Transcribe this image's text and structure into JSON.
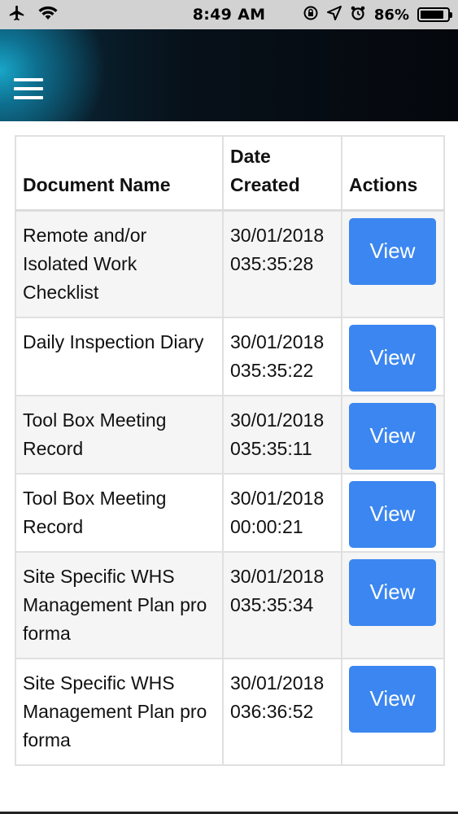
{
  "status_bar": {
    "time": "8:49 AM",
    "battery_text": "86%",
    "battery_level": 0.86,
    "icons": [
      "airplane-icon",
      "wifi-icon",
      "orientation-lock-icon",
      "location-arrow-icon",
      "alarm-icon",
      "battery-icon"
    ]
  },
  "header": {
    "menu_icon": "hamburger-menu-icon"
  },
  "table": {
    "headers": {
      "name": "Document Name",
      "date": "Date Created",
      "actions": "Actions"
    },
    "rows": [
      {
        "name": "Remote and/or Isolated Work Checklist",
        "date": "30/01/2018",
        "time": "035:35:28",
        "action": "View"
      },
      {
        "name": "Daily Inspection Diary",
        "date": "30/01/2018",
        "time": "035:35:22",
        "action": "View"
      },
      {
        "name": "Tool Box Meeting Record",
        "date": "30/01/2018",
        "time": "035:35:11",
        "action": "View"
      },
      {
        "name": "Tool Box Meeting Record",
        "date": "30/01/2018",
        "time": "00:00:21",
        "action": "View"
      },
      {
        "name": "Site Specific WHS Management Plan pro forma",
        "date": "30/01/2018",
        "time": "035:35:34",
        "action": "View"
      },
      {
        "name": "Site Specific WHS Management Plan pro forma",
        "date": "30/01/2018",
        "time": "036:36:52",
        "action": "View"
      }
    ]
  },
  "colors": {
    "status_bar_bg": "#d2d2d2",
    "button_bg": "#3b86f0",
    "row_alt_bg": "#f5f5f5"
  }
}
